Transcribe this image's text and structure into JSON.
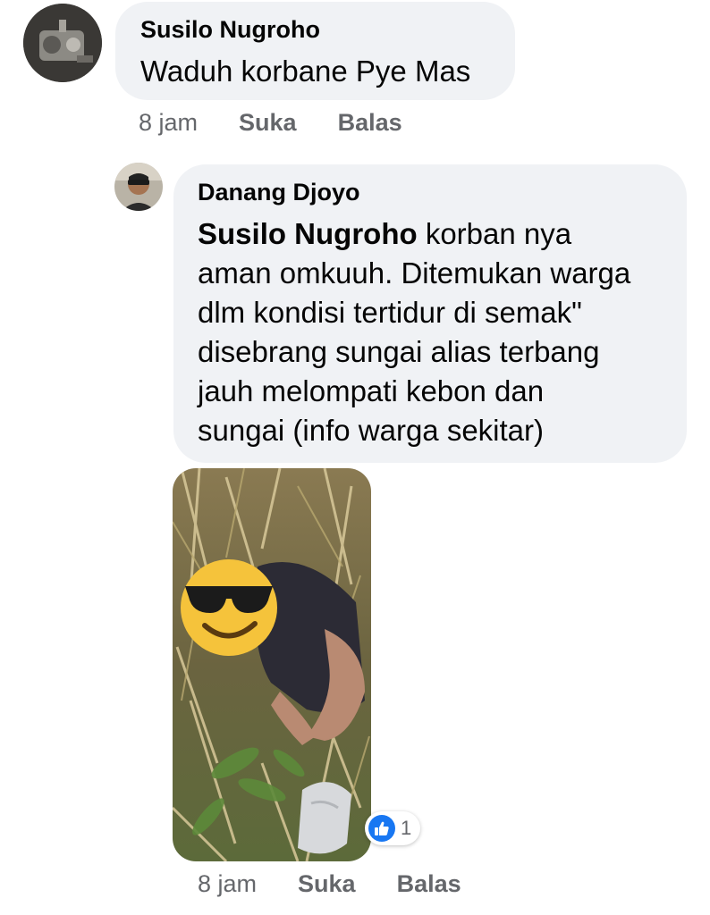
{
  "comment1": {
    "author": "Susilo Nugroho",
    "text": "Waduh korbane Pye Mas",
    "time": "8 jam",
    "like_label": "Suka",
    "reply_label": "Balas"
  },
  "reply1": {
    "author": "Danang Djoyo",
    "mention": "Susilo Nugroho",
    "lines": [
      " korban nya",
      "aman omkuuh. Ditemukan warga",
      "dlm kondisi tertidur di semak\"",
      "disebrang sungai alias terbang",
      "jauh melompati kebon dan",
      "sungai (info warga sekitar)"
    ],
    "reaction_count": "1",
    "time": "8 jam",
    "like_label": "Suka",
    "reply_label": "Balas"
  },
  "colors": {
    "bubble": "#f0f2f5",
    "secondary_text": "#65676b",
    "like_blue": "#1877f2"
  },
  "icons": {
    "reaction": "like-thumb-icon",
    "sticker": "sunglasses-emoji-icon"
  }
}
